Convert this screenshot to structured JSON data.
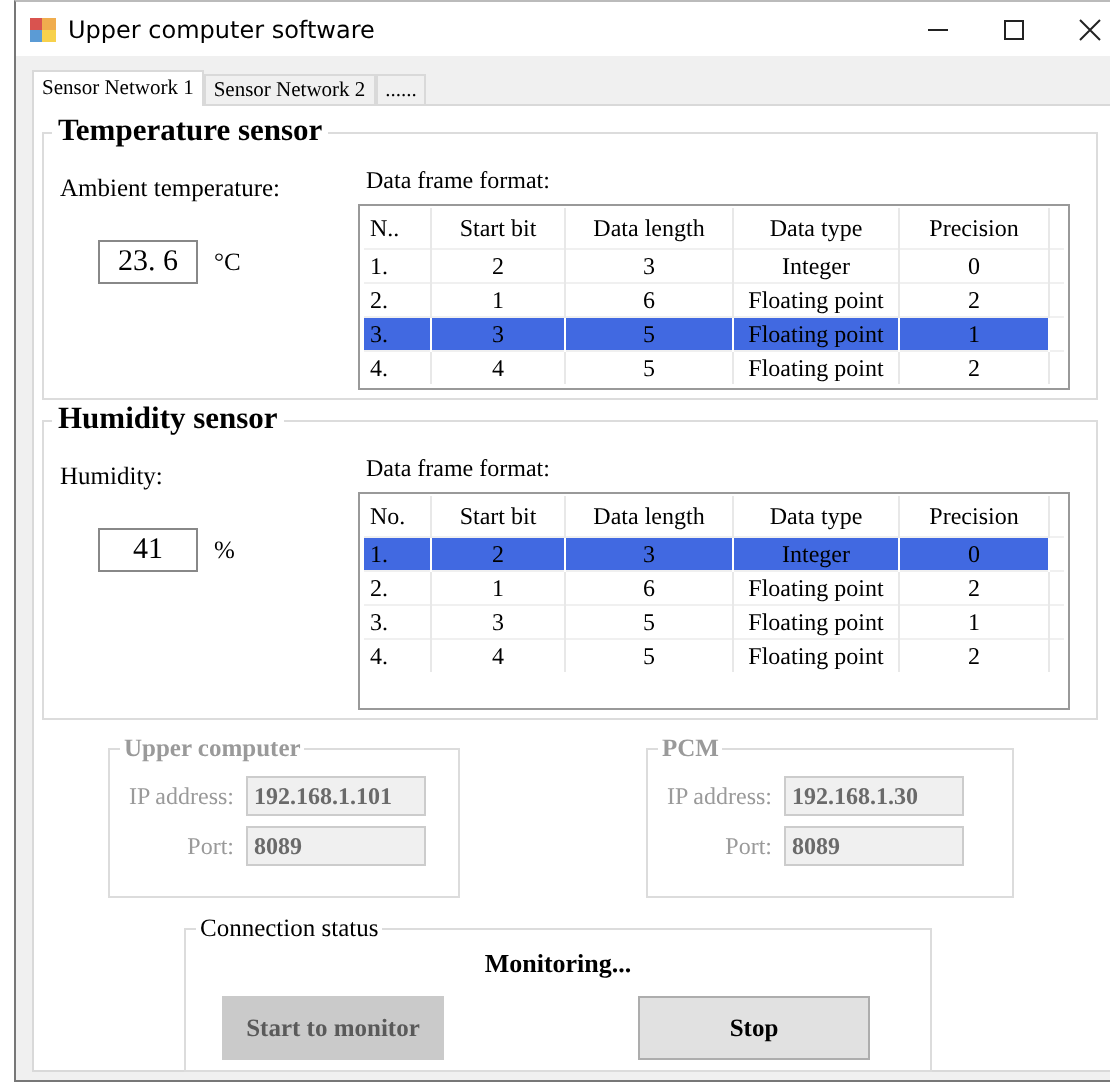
{
  "window": {
    "title": "Upper computer software"
  },
  "tabs": [
    {
      "label": "Sensor Network 1",
      "selected": true
    },
    {
      "label": "Sensor Network 2",
      "selected": false
    },
    {
      "label": "......",
      "selected": false
    }
  ],
  "sensors": [
    {
      "title": "Temperature sensor",
      "reading_label": "Ambient temperature:",
      "value": "23. 6",
      "unit": "°C",
      "table_label": "Data frame format:",
      "columns": [
        "N..",
        "Start bit",
        "Data length",
        "Data type",
        "Precision"
      ],
      "rows": [
        {
          "cells": [
            "1.",
            "2",
            "3",
            "Integer",
            "0"
          ],
          "selected": false
        },
        {
          "cells": [
            "2.",
            "1",
            "6",
            "Floating point",
            "2"
          ],
          "selected": false
        },
        {
          "cells": [
            "3.",
            "3",
            "5",
            "Floating point",
            "1"
          ],
          "selected": true
        },
        {
          "cells": [
            "4.",
            "4",
            "5",
            "Floating point",
            "2"
          ],
          "selected": false
        }
      ]
    },
    {
      "title": "Humidity sensor",
      "reading_label": "Humidity:",
      "value": "41",
      "unit": "%",
      "table_label": "Data frame format:",
      "columns": [
        "No.",
        "Start bit",
        "Data length",
        "Data type",
        "Precision"
      ],
      "rows": [
        {
          "cells": [
            "1.",
            "2",
            "3",
            "Integer",
            "0"
          ],
          "selected": true
        },
        {
          "cells": [
            "2.",
            "1",
            "6",
            "Floating point",
            "2"
          ],
          "selected": false
        },
        {
          "cells": [
            "3.",
            "3",
            "5",
            "Floating point",
            "1"
          ],
          "selected": false
        },
        {
          "cells": [
            "4.",
            "4",
            "5",
            "Floating point",
            "2"
          ],
          "selected": false
        }
      ]
    }
  ],
  "endpoints": [
    {
      "title": "Upper computer",
      "disabled": true,
      "fields": [
        {
          "label": "IP address:",
          "value": "192.168.1.101"
        },
        {
          "label": "Port:",
          "value": "8089"
        }
      ]
    },
    {
      "title": "PCM",
      "disabled": true,
      "fields": [
        {
          "label": "IP address:",
          "value": "192.168.1.30"
        },
        {
          "label": "Port:",
          "value": "8089"
        }
      ]
    }
  ],
  "connection": {
    "title": "Connection status",
    "status": "Monitoring...",
    "buttons": [
      {
        "label": "Start to monitor",
        "disabled": true
      },
      {
        "label": "Stop",
        "disabled": false
      }
    ]
  }
}
